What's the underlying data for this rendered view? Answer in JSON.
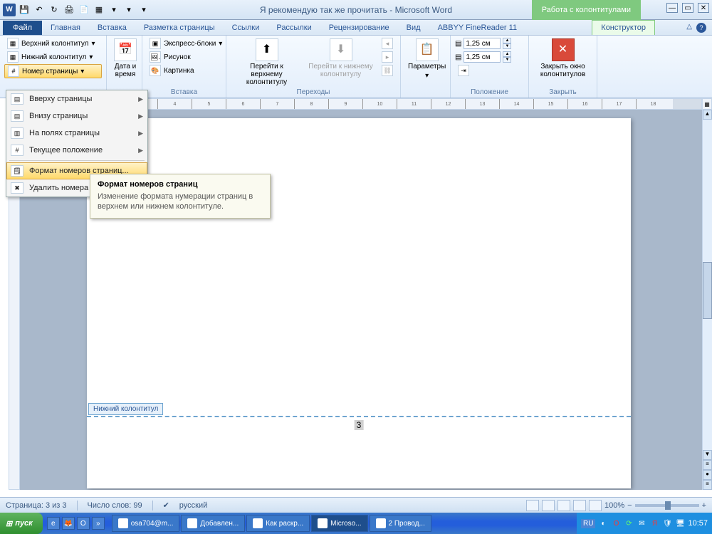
{
  "title": "Я рекомендую так же прочитать  -  Microsoft Word",
  "context_title": "Работа с колонтитулами",
  "tabs": {
    "file": "Файл",
    "home": "Главная",
    "insert": "Вставка",
    "layout": "Разметка страницы",
    "refs": "Ссылки",
    "mail": "Рассылки",
    "review": "Рецензирование",
    "view": "Вид",
    "abbyy": "ABBYY FineReader 11",
    "designer": "Конструктор"
  },
  "ribbon": {
    "hf": {
      "top": "Верхний колонтитул",
      "bottom": "Нижний колонтитул",
      "pagenum": "Номер страницы"
    },
    "datetime": {
      "label": "Дата и время"
    },
    "insert": {
      "quick": "Экспресс-блоки",
      "picture": "Рисунок",
      "clipart": "Картинка",
      "group": "Вставка"
    },
    "nav": {
      "gotop": "Перейти к верхнему колонтитулу",
      "gobottom": "Перейти к нижнему колонтитулу",
      "group": "Переходы"
    },
    "params": "Параметры",
    "position": {
      "top_val": "1,25 см",
      "bottom_val": "1,25 см",
      "group": "Положение"
    },
    "close": {
      "label": "Закрыть окно колонтитулов",
      "group": "Закрыть"
    }
  },
  "dropdown": {
    "top": "Вверху страницы",
    "bottom": "Внизу страницы",
    "margins": "На полях страницы",
    "current": "Текущее положение",
    "format": "Формат номеров страниц...",
    "remove": "Удалить номера"
  },
  "tooltip": {
    "title": "Формат номеров страниц",
    "body": "Изменение формата нумерации страниц в верхнем или нижнем колонтитуле."
  },
  "page": {
    "footer_label": "Нижний колонтитул",
    "page_number": "3"
  },
  "status": {
    "page": "Страница: 3 из 3",
    "words": "Число слов: 99",
    "lang": "русский",
    "zoom": "100%"
  },
  "taskbar": {
    "start": "пуск",
    "tasks": [
      "osa704@m...",
      "Добавлен...",
      "Как раскр...",
      "Microso...",
      "2 Провод..."
    ],
    "lang": "RU",
    "clock": "10:57"
  }
}
